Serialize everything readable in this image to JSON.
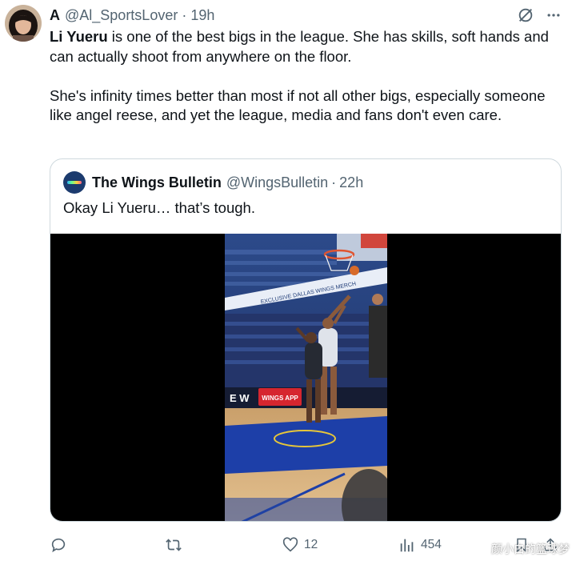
{
  "author": {
    "display_name": "A",
    "handle": "@Al_SportsLover",
    "separator": "·",
    "time": "19h"
  },
  "icons": {
    "avatar": "avatar-woman",
    "grok": "grok-icon",
    "more": "more-icon",
    "reply": "reply-icon",
    "retweet": "retweet-icon",
    "like": "heart-icon",
    "views": "views-chart-icon",
    "bookmark": "bookmark-icon",
    "share": "share-icon"
  },
  "tweet": {
    "highlight": "Li Yueru",
    "line1_rest": " is one of the best bigs in the league. She has skills, soft hands and can actually shoot from anywhere on the floor.",
    "paragraph2": "She's infinity times better than most if not all other bigs, especially someone like angel reese, and yet the league, media and fans don't even care."
  },
  "quote": {
    "display_name": "The Wings Bulletin",
    "handle": "@WingsBulletin",
    "separator": "·",
    "time": "22h",
    "text": "Okay Li Yueru… that’s tough.",
    "video": {
      "banner_text": "EXCLUSIVE DALLAS WINGS MERCH",
      "ad_board_left": "E W",
      "ad_board_right": "WINGS APP"
    }
  },
  "actions": {
    "reply_count": "",
    "retweet_count": "",
    "like_count": "12",
    "views_count": "454"
  },
  "watermark": "颜小白的篮球梦",
  "colors": {
    "text": "#0f1419",
    "secondary": "#536471",
    "border": "#cfd9de",
    "video_bg": "#000000"
  }
}
